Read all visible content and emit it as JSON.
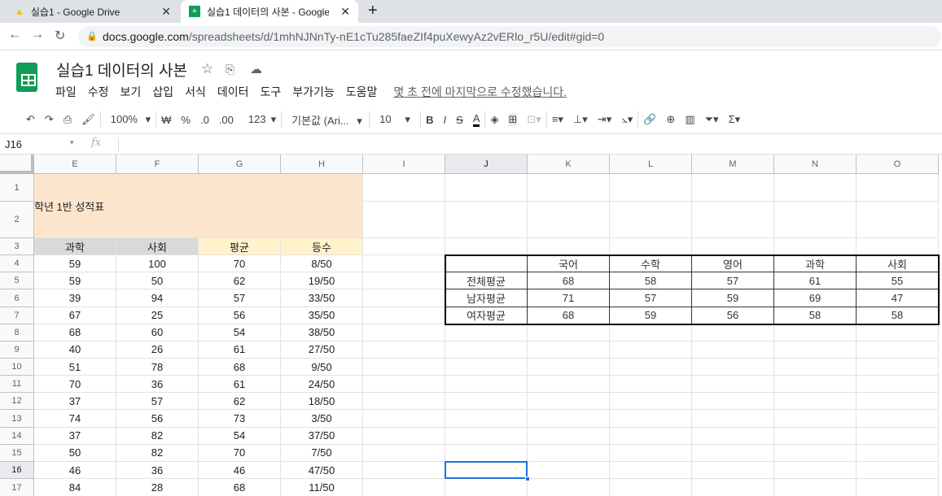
{
  "browser": {
    "tabs": [
      {
        "title": "실습1 - Google Drive",
        "icon": "google-drive-icon"
      },
      {
        "title": "실습1 데이터의 사본 - Google S",
        "icon": "google-sheets-icon"
      }
    ],
    "url_host": "docs.google.com",
    "url_path": "/spreadsheets/d/1mhNJNnTy-nE1cTu285faeZIf4puXewyAz2vERlo_r5U/edit#gid=0"
  },
  "doc": {
    "title": "실습1 데이터의 사본",
    "menu": [
      "파일",
      "수정",
      "보기",
      "삽입",
      "서식",
      "데이터",
      "도구",
      "부가기능",
      "도움말"
    ],
    "last_edit": "몇 초 전에 마지막으로 수정했습니다."
  },
  "toolbar": {
    "zoom": "100%",
    "currency": "₩",
    "percent": "%",
    "dec_less": ".0",
    "dec_more": ".00",
    "format": "123",
    "font": "기본값 (Ari...",
    "size": "10"
  },
  "formula_bar": {
    "cell_ref": "J16",
    "fx": "fx",
    "value": ""
  },
  "columns": [
    "E",
    "F",
    "G",
    "H",
    "I",
    "J",
    "K",
    "L",
    "M",
    "N",
    "O"
  ],
  "rows": [
    "1",
    "2",
    "3",
    "4",
    "5",
    "6",
    "7",
    "8",
    "9",
    "10",
    "11",
    "12",
    "13",
    "14",
    "15",
    "16",
    "17"
  ],
  "selected_cell": "J16",
  "sheet": {
    "title": "학년 1반 성적표",
    "headers": [
      "과학",
      "사회",
      "평균",
      "등수"
    ],
    "data": [
      [
        "59",
        "100",
        "70",
        "8/50"
      ],
      [
        "59",
        "50",
        "62",
        "19/50"
      ],
      [
        "39",
        "94",
        "57",
        "33/50"
      ],
      [
        "67",
        "25",
        "56",
        "35/50"
      ],
      [
        "68",
        "60",
        "54",
        "38/50"
      ],
      [
        "40",
        "26",
        "61",
        "27/50"
      ],
      [
        "51",
        "78",
        "68",
        "9/50"
      ],
      [
        "70",
        "36",
        "61",
        "24/50"
      ],
      [
        "37",
        "57",
        "62",
        "18/50"
      ],
      [
        "74",
        "56",
        "73",
        "3/50"
      ],
      [
        "37",
        "82",
        "54",
        "37/50"
      ],
      [
        "50",
        "82",
        "70",
        "7/50"
      ],
      [
        "46",
        "36",
        "46",
        "47/50"
      ],
      [
        "84",
        "28",
        "68",
        "11/50"
      ]
    ]
  },
  "summary": {
    "headers": [
      "",
      "국어",
      "수학",
      "영어",
      "과학",
      "사회"
    ],
    "rows": [
      [
        "전체평균",
        "68",
        "58",
        "57",
        "61",
        "55"
      ],
      [
        "남자평균",
        "71",
        "57",
        "59",
        "69",
        "47"
      ],
      [
        "여자평균",
        "68",
        "59",
        "56",
        "58",
        "58"
      ]
    ]
  },
  "colors": {
    "title_fill": "#fce5cd",
    "gray_header": "#d9d9d9",
    "yellow_header": "#fff2cc",
    "selection": "#1a73e8"
  }
}
